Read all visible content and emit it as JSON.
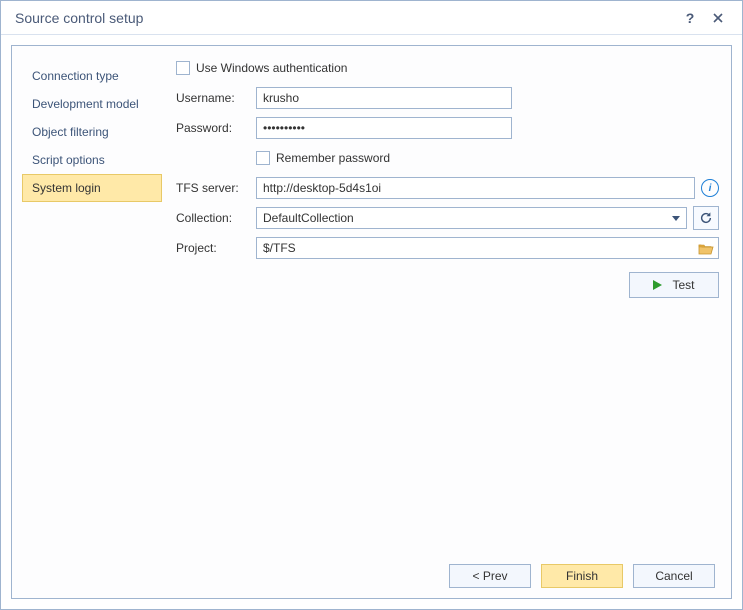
{
  "window": {
    "title": "Source control setup"
  },
  "sidebar": {
    "items": [
      {
        "label": "Connection type"
      },
      {
        "label": "Development model"
      },
      {
        "label": "Object filtering"
      },
      {
        "label": "Script options"
      },
      {
        "label": "System login",
        "selected": true
      }
    ]
  },
  "form": {
    "use_win_auth_label": "Use Windows authentication",
    "username_label": "Username:",
    "username_value": "krusho",
    "password_label": "Password:",
    "password_value": "••••••••••",
    "remember_label": "Remember password",
    "tfs_label": "TFS server:",
    "tfs_value": "http://desktop-5d4s1oi",
    "collection_label": "Collection:",
    "collection_value": "DefaultCollection",
    "project_label": "Project:",
    "project_value": "$/TFS",
    "test_label": "Test"
  },
  "footer": {
    "prev": "< Prev",
    "finish": "Finish",
    "cancel": "Cancel"
  }
}
